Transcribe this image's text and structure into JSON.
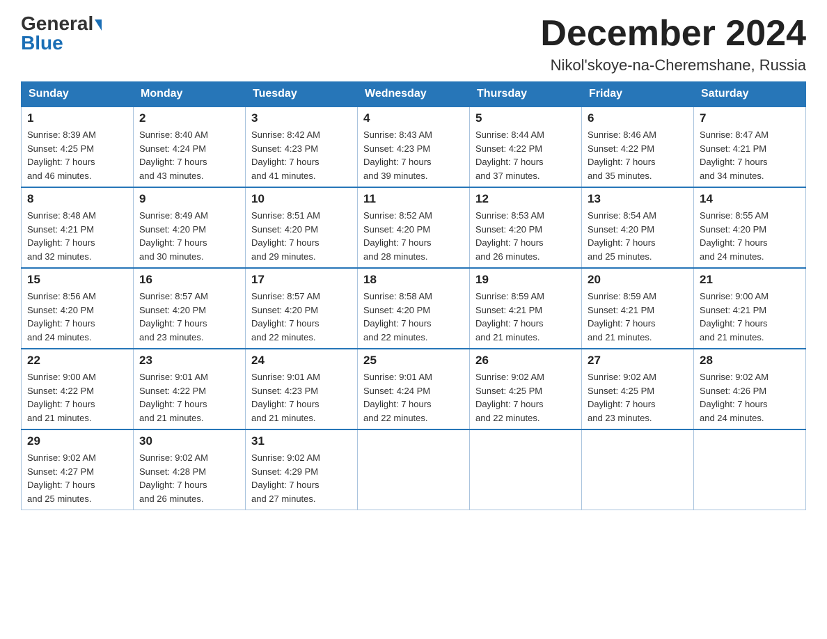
{
  "header": {
    "logo_line1": "General",
    "logo_line2": "Blue",
    "month_title": "December 2024",
    "location": "Nikol'skoye-na-Cheremshane, Russia"
  },
  "days_of_week": [
    "Sunday",
    "Monday",
    "Tuesday",
    "Wednesday",
    "Thursday",
    "Friday",
    "Saturday"
  ],
  "weeks": [
    [
      {
        "day": "1",
        "info": "Sunrise: 8:39 AM\nSunset: 4:25 PM\nDaylight: 7 hours\nand 46 minutes."
      },
      {
        "day": "2",
        "info": "Sunrise: 8:40 AM\nSunset: 4:24 PM\nDaylight: 7 hours\nand 43 minutes."
      },
      {
        "day": "3",
        "info": "Sunrise: 8:42 AM\nSunset: 4:23 PM\nDaylight: 7 hours\nand 41 minutes."
      },
      {
        "day": "4",
        "info": "Sunrise: 8:43 AM\nSunset: 4:23 PM\nDaylight: 7 hours\nand 39 minutes."
      },
      {
        "day": "5",
        "info": "Sunrise: 8:44 AM\nSunset: 4:22 PM\nDaylight: 7 hours\nand 37 minutes."
      },
      {
        "day": "6",
        "info": "Sunrise: 8:46 AM\nSunset: 4:22 PM\nDaylight: 7 hours\nand 35 minutes."
      },
      {
        "day": "7",
        "info": "Sunrise: 8:47 AM\nSunset: 4:21 PM\nDaylight: 7 hours\nand 34 minutes."
      }
    ],
    [
      {
        "day": "8",
        "info": "Sunrise: 8:48 AM\nSunset: 4:21 PM\nDaylight: 7 hours\nand 32 minutes."
      },
      {
        "day": "9",
        "info": "Sunrise: 8:49 AM\nSunset: 4:20 PM\nDaylight: 7 hours\nand 30 minutes."
      },
      {
        "day": "10",
        "info": "Sunrise: 8:51 AM\nSunset: 4:20 PM\nDaylight: 7 hours\nand 29 minutes."
      },
      {
        "day": "11",
        "info": "Sunrise: 8:52 AM\nSunset: 4:20 PM\nDaylight: 7 hours\nand 28 minutes."
      },
      {
        "day": "12",
        "info": "Sunrise: 8:53 AM\nSunset: 4:20 PM\nDaylight: 7 hours\nand 26 minutes."
      },
      {
        "day": "13",
        "info": "Sunrise: 8:54 AM\nSunset: 4:20 PM\nDaylight: 7 hours\nand 25 minutes."
      },
      {
        "day": "14",
        "info": "Sunrise: 8:55 AM\nSunset: 4:20 PM\nDaylight: 7 hours\nand 24 minutes."
      }
    ],
    [
      {
        "day": "15",
        "info": "Sunrise: 8:56 AM\nSunset: 4:20 PM\nDaylight: 7 hours\nand 24 minutes."
      },
      {
        "day": "16",
        "info": "Sunrise: 8:57 AM\nSunset: 4:20 PM\nDaylight: 7 hours\nand 23 minutes."
      },
      {
        "day": "17",
        "info": "Sunrise: 8:57 AM\nSunset: 4:20 PM\nDaylight: 7 hours\nand 22 minutes."
      },
      {
        "day": "18",
        "info": "Sunrise: 8:58 AM\nSunset: 4:20 PM\nDaylight: 7 hours\nand 22 minutes."
      },
      {
        "day": "19",
        "info": "Sunrise: 8:59 AM\nSunset: 4:21 PM\nDaylight: 7 hours\nand 21 minutes."
      },
      {
        "day": "20",
        "info": "Sunrise: 8:59 AM\nSunset: 4:21 PM\nDaylight: 7 hours\nand 21 minutes."
      },
      {
        "day": "21",
        "info": "Sunrise: 9:00 AM\nSunset: 4:21 PM\nDaylight: 7 hours\nand 21 minutes."
      }
    ],
    [
      {
        "day": "22",
        "info": "Sunrise: 9:00 AM\nSunset: 4:22 PM\nDaylight: 7 hours\nand 21 minutes."
      },
      {
        "day": "23",
        "info": "Sunrise: 9:01 AM\nSunset: 4:22 PM\nDaylight: 7 hours\nand 21 minutes."
      },
      {
        "day": "24",
        "info": "Sunrise: 9:01 AM\nSunset: 4:23 PM\nDaylight: 7 hours\nand 21 minutes."
      },
      {
        "day": "25",
        "info": "Sunrise: 9:01 AM\nSunset: 4:24 PM\nDaylight: 7 hours\nand 22 minutes."
      },
      {
        "day": "26",
        "info": "Sunrise: 9:02 AM\nSunset: 4:25 PM\nDaylight: 7 hours\nand 22 minutes."
      },
      {
        "day": "27",
        "info": "Sunrise: 9:02 AM\nSunset: 4:25 PM\nDaylight: 7 hours\nand 23 minutes."
      },
      {
        "day": "28",
        "info": "Sunrise: 9:02 AM\nSunset: 4:26 PM\nDaylight: 7 hours\nand 24 minutes."
      }
    ],
    [
      {
        "day": "29",
        "info": "Sunrise: 9:02 AM\nSunset: 4:27 PM\nDaylight: 7 hours\nand 25 minutes."
      },
      {
        "day": "30",
        "info": "Sunrise: 9:02 AM\nSunset: 4:28 PM\nDaylight: 7 hours\nand 26 minutes."
      },
      {
        "day": "31",
        "info": "Sunrise: 9:02 AM\nSunset: 4:29 PM\nDaylight: 7 hours\nand 27 minutes."
      },
      {
        "day": "",
        "info": ""
      },
      {
        "day": "",
        "info": ""
      },
      {
        "day": "",
        "info": ""
      },
      {
        "day": "",
        "info": ""
      }
    ]
  ]
}
